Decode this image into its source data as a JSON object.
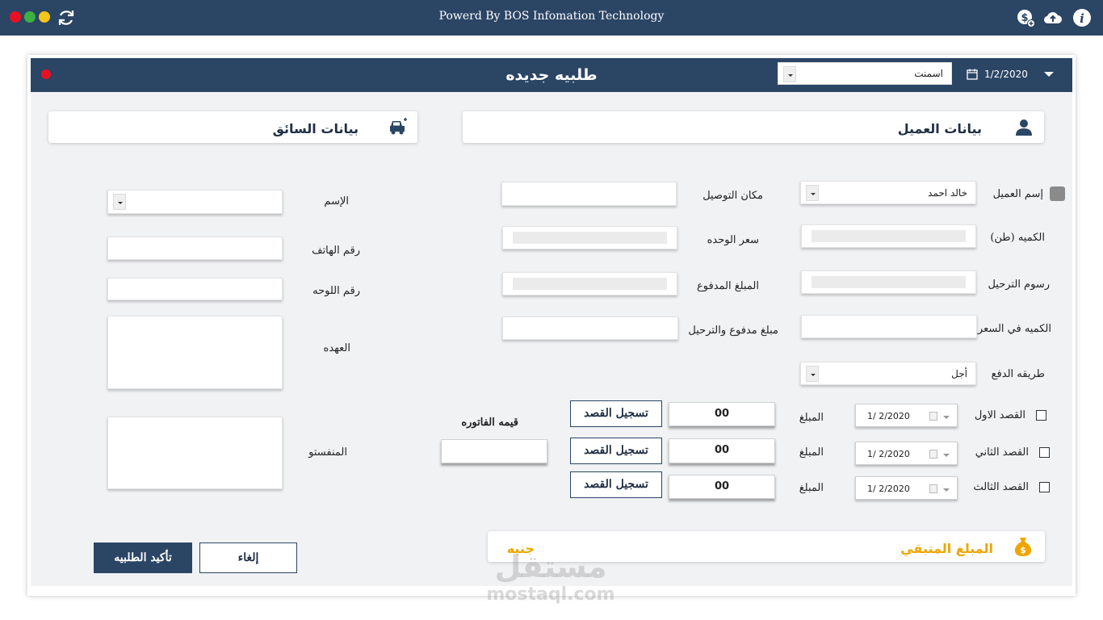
{
  "app": {
    "title": "Powerd By BOS Infomation Technology",
    "colors": {
      "header": "#2b4565",
      "close": "#e81123",
      "minimize": "#3cb043",
      "maximize": "#f5c518",
      "accent": "#f0a500"
    }
  },
  "header": {
    "title": "طلبيه جديده",
    "material_select": "اسمنت",
    "date": "1/2/2020"
  },
  "customer": {
    "title": "بيانات العميل",
    "name_label": "إسم العميل",
    "name_value": "خالد احمد",
    "quantity_label": "الكميه (طن)",
    "shipping_fee_label": "رسوم الترحيل",
    "quantity_price_label": "الكميه في السعر",
    "payment_method_label": "طريقه الدفع",
    "payment_method_value": "أجل",
    "delivery_place_label": "مكان التوصيل",
    "unit_price_label": "سعر الوحده",
    "paid_amount_label": "المبلغ المدفوع",
    "paid_and_shipping_label": "مبلغ مدفوع والترحيل"
  },
  "installments": {
    "rows": [
      {
        "label": "القصد الاول",
        "date": "1/  2/2020",
        "amount_label": "المبلغ",
        "amount": "00",
        "button": "تسجيل القصد"
      },
      {
        "label": "القصد الثاني",
        "date": "1/  2/2020",
        "amount_label": "المبلغ",
        "amount": "00",
        "button": "تسجيل القصد"
      },
      {
        "label": "القصد الثالث",
        "date": "1/  2/2020",
        "amount_label": "المبلغ",
        "amount": "00",
        "button": "تسجيل القصد"
      }
    ],
    "invoice_label": "قيمه الفاتوره"
  },
  "remaining": {
    "label": "المبلغ المتبقي",
    "currency": "جنيه"
  },
  "driver": {
    "title": "بيانات السائق",
    "name_label": "الإسم",
    "phone_label": "رقم الهاتف",
    "plate_label": "رقم اللوحه",
    "custody_label": "العهده",
    "manifest_label": "المنفستو"
  },
  "actions": {
    "cancel": "إلغاء",
    "confirm": "تأكيد الطلبيه"
  },
  "watermark": {
    "brand": "مستقل",
    "site": "mostaql.com"
  }
}
